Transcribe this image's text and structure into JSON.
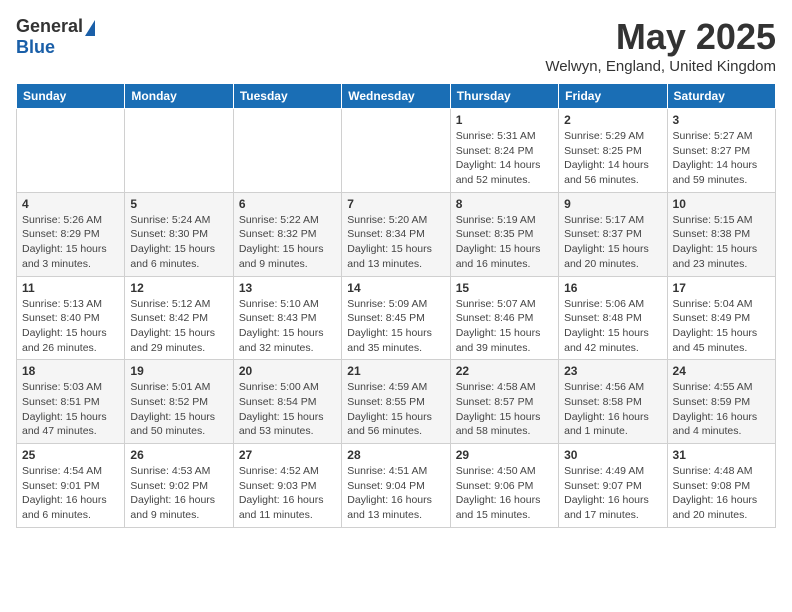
{
  "header": {
    "logo_general": "General",
    "logo_blue": "Blue",
    "month_title": "May 2025",
    "location": "Welwyn, England, United Kingdom"
  },
  "weekdays": [
    "Sunday",
    "Monday",
    "Tuesday",
    "Wednesday",
    "Thursday",
    "Friday",
    "Saturday"
  ],
  "weeks": [
    [
      {
        "day": "",
        "info": ""
      },
      {
        "day": "",
        "info": ""
      },
      {
        "day": "",
        "info": ""
      },
      {
        "day": "",
        "info": ""
      },
      {
        "day": "1",
        "info": "Sunrise: 5:31 AM\nSunset: 8:24 PM\nDaylight: 14 hours\nand 52 minutes."
      },
      {
        "day": "2",
        "info": "Sunrise: 5:29 AM\nSunset: 8:25 PM\nDaylight: 14 hours\nand 56 minutes."
      },
      {
        "day": "3",
        "info": "Sunrise: 5:27 AM\nSunset: 8:27 PM\nDaylight: 14 hours\nand 59 minutes."
      }
    ],
    [
      {
        "day": "4",
        "info": "Sunrise: 5:26 AM\nSunset: 8:29 PM\nDaylight: 15 hours\nand 3 minutes."
      },
      {
        "day": "5",
        "info": "Sunrise: 5:24 AM\nSunset: 8:30 PM\nDaylight: 15 hours\nand 6 minutes."
      },
      {
        "day": "6",
        "info": "Sunrise: 5:22 AM\nSunset: 8:32 PM\nDaylight: 15 hours\nand 9 minutes."
      },
      {
        "day": "7",
        "info": "Sunrise: 5:20 AM\nSunset: 8:34 PM\nDaylight: 15 hours\nand 13 minutes."
      },
      {
        "day": "8",
        "info": "Sunrise: 5:19 AM\nSunset: 8:35 PM\nDaylight: 15 hours\nand 16 minutes."
      },
      {
        "day": "9",
        "info": "Sunrise: 5:17 AM\nSunset: 8:37 PM\nDaylight: 15 hours\nand 20 minutes."
      },
      {
        "day": "10",
        "info": "Sunrise: 5:15 AM\nSunset: 8:38 PM\nDaylight: 15 hours\nand 23 minutes."
      }
    ],
    [
      {
        "day": "11",
        "info": "Sunrise: 5:13 AM\nSunset: 8:40 PM\nDaylight: 15 hours\nand 26 minutes."
      },
      {
        "day": "12",
        "info": "Sunrise: 5:12 AM\nSunset: 8:42 PM\nDaylight: 15 hours\nand 29 minutes."
      },
      {
        "day": "13",
        "info": "Sunrise: 5:10 AM\nSunset: 8:43 PM\nDaylight: 15 hours\nand 32 minutes."
      },
      {
        "day": "14",
        "info": "Sunrise: 5:09 AM\nSunset: 8:45 PM\nDaylight: 15 hours\nand 35 minutes."
      },
      {
        "day": "15",
        "info": "Sunrise: 5:07 AM\nSunset: 8:46 PM\nDaylight: 15 hours\nand 39 minutes."
      },
      {
        "day": "16",
        "info": "Sunrise: 5:06 AM\nSunset: 8:48 PM\nDaylight: 15 hours\nand 42 minutes."
      },
      {
        "day": "17",
        "info": "Sunrise: 5:04 AM\nSunset: 8:49 PM\nDaylight: 15 hours\nand 45 minutes."
      }
    ],
    [
      {
        "day": "18",
        "info": "Sunrise: 5:03 AM\nSunset: 8:51 PM\nDaylight: 15 hours\nand 47 minutes."
      },
      {
        "day": "19",
        "info": "Sunrise: 5:01 AM\nSunset: 8:52 PM\nDaylight: 15 hours\nand 50 minutes."
      },
      {
        "day": "20",
        "info": "Sunrise: 5:00 AM\nSunset: 8:54 PM\nDaylight: 15 hours\nand 53 minutes."
      },
      {
        "day": "21",
        "info": "Sunrise: 4:59 AM\nSunset: 8:55 PM\nDaylight: 15 hours\nand 56 minutes."
      },
      {
        "day": "22",
        "info": "Sunrise: 4:58 AM\nSunset: 8:57 PM\nDaylight: 15 hours\nand 58 minutes."
      },
      {
        "day": "23",
        "info": "Sunrise: 4:56 AM\nSunset: 8:58 PM\nDaylight: 16 hours\nand 1 minute."
      },
      {
        "day": "24",
        "info": "Sunrise: 4:55 AM\nSunset: 8:59 PM\nDaylight: 16 hours\nand 4 minutes."
      }
    ],
    [
      {
        "day": "25",
        "info": "Sunrise: 4:54 AM\nSunset: 9:01 PM\nDaylight: 16 hours\nand 6 minutes."
      },
      {
        "day": "26",
        "info": "Sunrise: 4:53 AM\nSunset: 9:02 PM\nDaylight: 16 hours\nand 9 minutes."
      },
      {
        "day": "27",
        "info": "Sunrise: 4:52 AM\nSunset: 9:03 PM\nDaylight: 16 hours\nand 11 minutes."
      },
      {
        "day": "28",
        "info": "Sunrise: 4:51 AM\nSunset: 9:04 PM\nDaylight: 16 hours\nand 13 minutes."
      },
      {
        "day": "29",
        "info": "Sunrise: 4:50 AM\nSunset: 9:06 PM\nDaylight: 16 hours\nand 15 minutes."
      },
      {
        "day": "30",
        "info": "Sunrise: 4:49 AM\nSunset: 9:07 PM\nDaylight: 16 hours\nand 17 minutes."
      },
      {
        "day": "31",
        "info": "Sunrise: 4:48 AM\nSunset: 9:08 PM\nDaylight: 16 hours\nand 20 minutes."
      }
    ]
  ]
}
